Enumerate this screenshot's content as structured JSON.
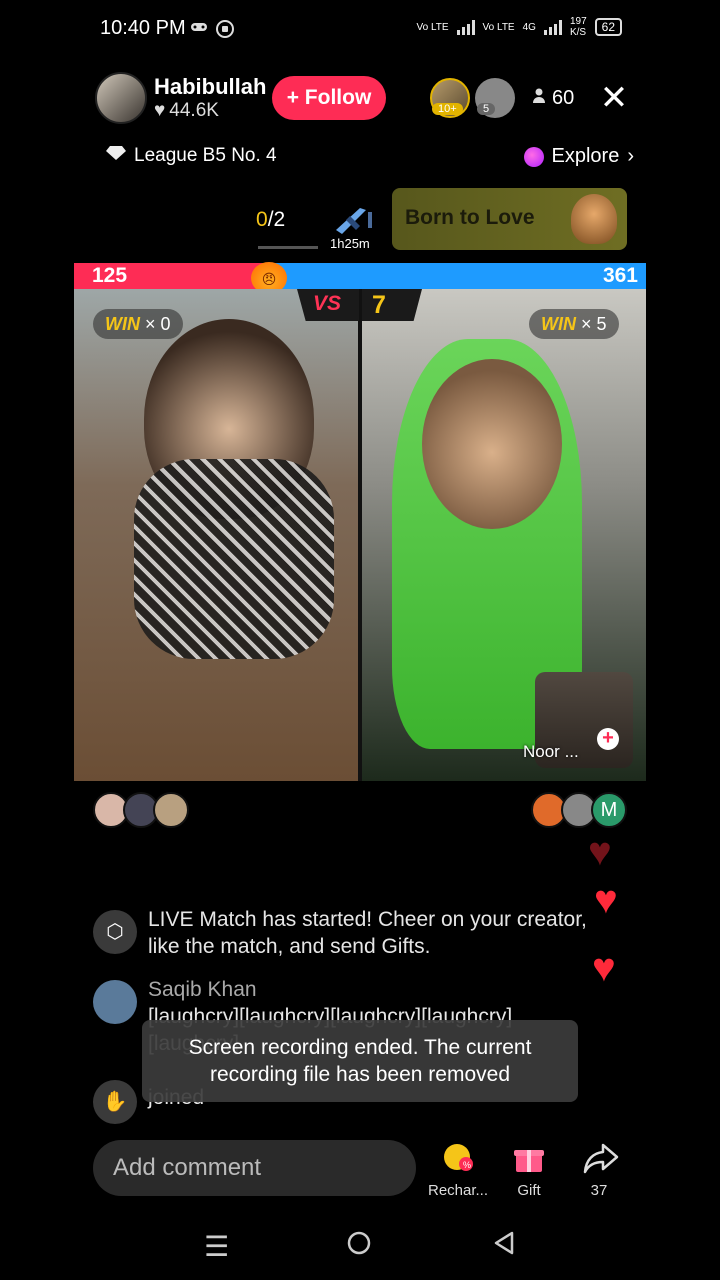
{
  "status_bar": {
    "time": "10:40 PM",
    "net1": "Vo LTE",
    "net2": "Vo LTE",
    "net3": "4G",
    "speed": "197",
    "speed_unit": "K/S",
    "battery": "62"
  },
  "host": {
    "name": "Habibullah",
    "likes": "44.6K",
    "follow_label": "+ Follow"
  },
  "viewers": {
    "badge1": "10+",
    "badge2": "5",
    "count": "60"
  },
  "league": "League B5 No. 4",
  "explore": "Explore",
  "progress": {
    "done": "0",
    "total": "/2"
  },
  "timer": "1h25m",
  "banner": "Born to Love",
  "battle": {
    "left_score": "125",
    "right_score": "361",
    "vs_label": "VS",
    "round": "7",
    "left_win_label": "WIN",
    "left_win_count": "× 0",
    "right_win_label": "WIN",
    "right_win_count": "× 5"
  },
  "cohost_name": "Noor ...",
  "gifters_right_letter": "M",
  "chat": [
    {
      "text": "LIVE Match has started! Cheer on your creator, like the match, and send Gifts."
    },
    {
      "name": "Saqib Khan",
      "text": "[laughcry][laughcry][laughcry][laughcry][laughcry]"
    },
    {
      "text": "joined"
    }
  ],
  "toast": "Screen recording ended. The current recording file has been removed",
  "comment_placeholder": "Add comment",
  "bottom_actions": {
    "recharge": "Rechar...",
    "gift": "Gift",
    "share_count": "37"
  },
  "colors": {
    "accent": "#fe2c55",
    "blue": "#1e9bff",
    "gold": "#f5c518"
  }
}
